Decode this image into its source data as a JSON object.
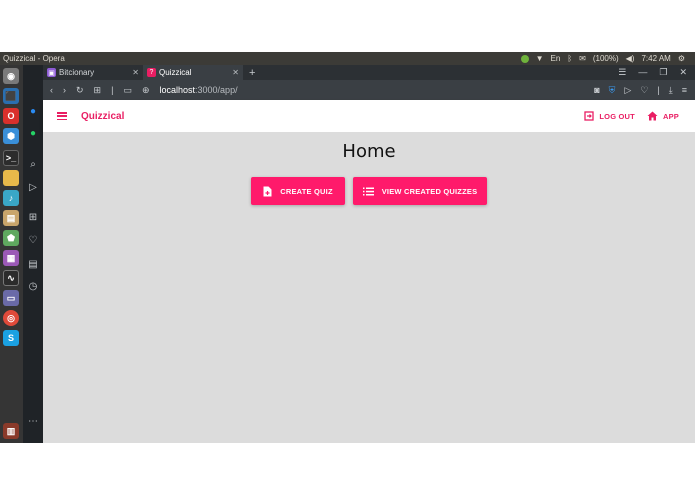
{
  "os": {
    "window_title": "Quizzical - Opera",
    "battery": "(100%)",
    "clock": "7:42 AM"
  },
  "browser": {
    "tabs": [
      {
        "label": "Bitcionary",
        "active": false
      },
      {
        "label": "Quizzical",
        "active": true
      }
    ],
    "url_host": "localhost",
    "url_path": ":3000/app/"
  },
  "app": {
    "brand": "Quizzical",
    "logout_label": "LOG OUT",
    "app_label": "APP",
    "page_title": "Home",
    "create_quiz_label": "CREATE QUIZ",
    "view_quizzes_label": "VIEW CREATED QUIZZES",
    "accent_color": "#e91e63",
    "button_color": "#ff1a6b"
  },
  "icons": {
    "launcher": [
      "dash-icon",
      "opera-icon",
      "files-icon",
      "terminal-icon",
      "folder-icon",
      "sound-icon",
      "android-icon",
      "system-monitor-icon",
      "chrome-icon",
      "skype-icon",
      "trash-icon"
    ],
    "opera_sidebar": [
      "messenger-icon",
      "whatsapp-icon",
      "search-icon",
      "send-icon",
      "speed-dial-icon",
      "heart-icon",
      "news-icon",
      "history-icon",
      "more-icon"
    ]
  }
}
